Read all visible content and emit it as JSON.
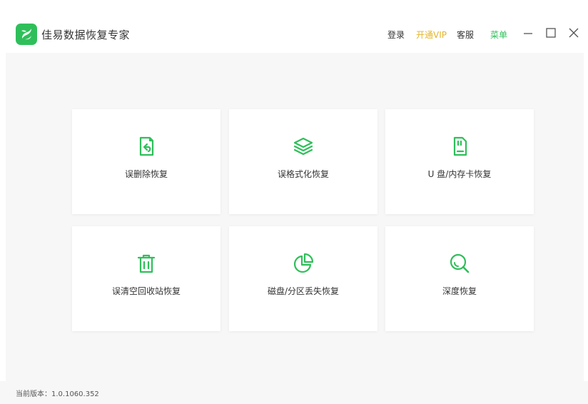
{
  "app": {
    "title": "佳易数据恢复专家"
  },
  "header": {
    "login": "登录",
    "vip": "开通VIP",
    "service": "客服",
    "menu": "菜单"
  },
  "cards": [
    {
      "label": "误删除恢复",
      "icon": "file-restore-icon"
    },
    {
      "label": "误格式化恢复",
      "icon": "layers-icon"
    },
    {
      "label": "U 盘/内存卡恢复",
      "icon": "sd-card-icon"
    },
    {
      "label": "误清空回收站恢复",
      "icon": "trash-icon"
    },
    {
      "label": "磁盘/分区丢失恢复",
      "icon": "pie-chart-icon"
    },
    {
      "label": "深度恢复",
      "icon": "search-icon"
    }
  ],
  "footer": {
    "version": "当前版本：1.0.1060.352"
  },
  "colors": {
    "brand": "#2fbf5a",
    "vip": "#e3b529",
    "background": "#f7f7f7"
  }
}
